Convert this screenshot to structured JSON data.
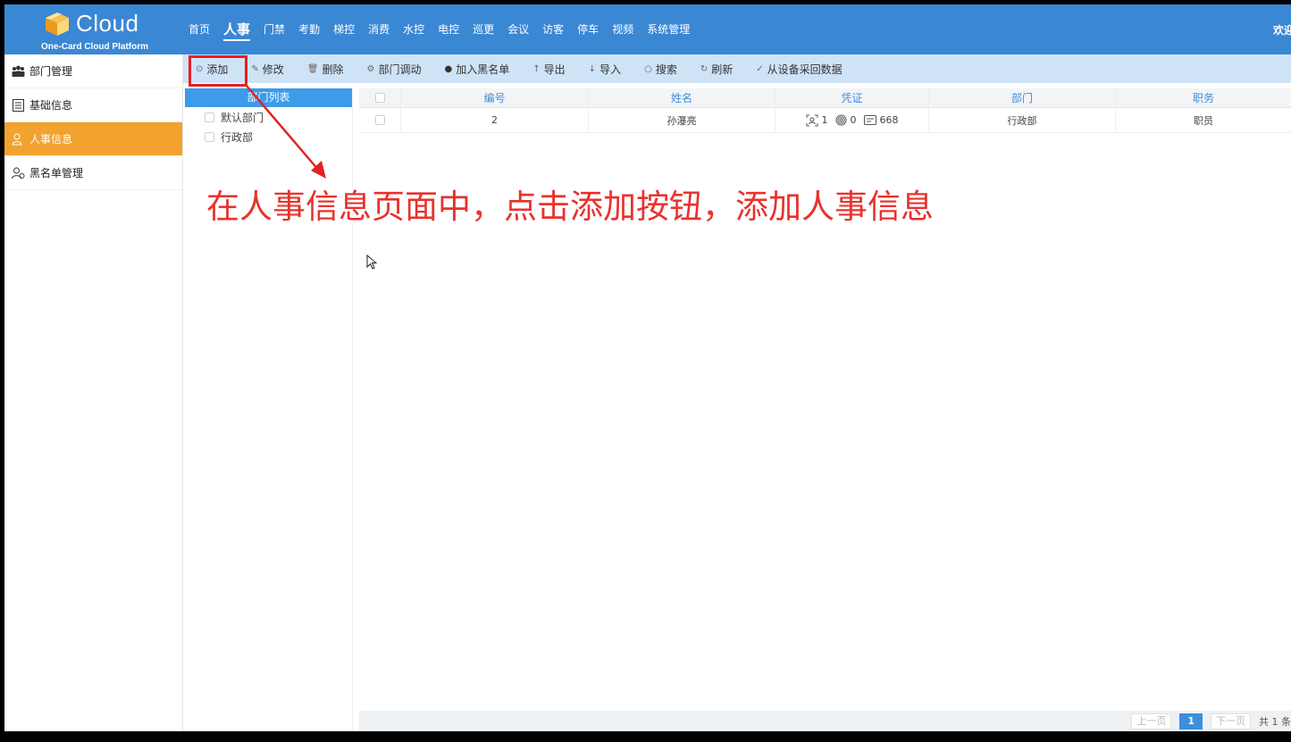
{
  "header": {
    "logo_word": "Cloud",
    "logo_subtitle": "One-Card Cloud Platform",
    "welcome": "欢迎",
    "nav": [
      {
        "label": "首页"
      },
      {
        "label": "人事",
        "active": true
      },
      {
        "label": "门禁"
      },
      {
        "label": "考勤"
      },
      {
        "label": "梯控"
      },
      {
        "label": "消费"
      },
      {
        "label": "水控"
      },
      {
        "label": "电控"
      },
      {
        "label": "巡更"
      },
      {
        "label": "会议"
      },
      {
        "label": "访客"
      },
      {
        "label": "停车"
      },
      {
        "label": "视频"
      },
      {
        "label": "系统管理"
      }
    ]
  },
  "sidebar": {
    "items": [
      {
        "label": "部门管理",
        "icon": "group-icon"
      },
      {
        "label": "基础信息",
        "icon": "document-list-icon"
      },
      {
        "label": "人事信息",
        "icon": "person-icon",
        "active": true
      },
      {
        "label": "黑名单管理",
        "icon": "blacklist-user-icon"
      }
    ]
  },
  "toolbar": {
    "add": "添加",
    "edit": "修改",
    "delete": "删除",
    "transfer": "部门调动",
    "blacklist": "加入黑名单",
    "export": "导出",
    "import": "导入",
    "search": "搜索",
    "refresh": "刷新",
    "fetch": "从设备采回数据"
  },
  "dept_panel": {
    "title": "部门列表",
    "items": [
      "默认部门",
      "行政部"
    ]
  },
  "table": {
    "columns": [
      "编号",
      "姓名",
      "凭证",
      "部门",
      "职务"
    ],
    "rows": [
      {
        "id": "2",
        "name": "孙瀑亮",
        "face": "1",
        "fingerprint": "0",
        "card": "668",
        "dept": "行政部",
        "position": "职员"
      }
    ]
  },
  "annotation": "在人事信息页面中，点击添加按钮，添加人事信息",
  "pagination": {
    "prev": "上一页",
    "current": "1",
    "next": "下一页",
    "total": "共 1 条"
  },
  "colors": {
    "header_bg": "#3a87d4",
    "active_sidebar": "#f2a22f",
    "toolbar_bg": "#cfe3f7",
    "annotation": "#e8322d"
  }
}
